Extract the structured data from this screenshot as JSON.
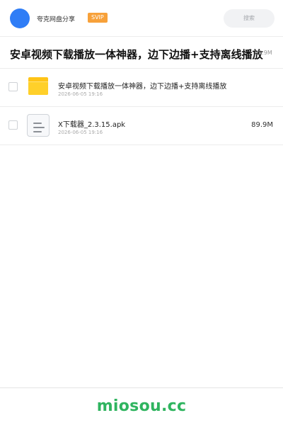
{
  "header": {
    "app_name": "夸克网盘分享",
    "badge": "SVIP",
    "search_placeholder": "搜索",
    "avatar_color": "#2f7df6",
    "badge_color": "#f7a13a"
  },
  "folder": {
    "title": "安卓视频下载播放一体神器，边下边播+支持离线播放",
    "total_size": "89.9M"
  },
  "files": [
    {
      "icon": "folder-icon",
      "name": "安卓视频下载播放一体神器，边下边播+支持离线播放",
      "date": "2026-06-05 19:16",
      "size": ""
    },
    {
      "icon": "apk-file-icon",
      "name": "X下载器_2.3.15.apk",
      "date": "2026-06-05 19:16",
      "size": "89.9M"
    }
  ],
  "footer": {
    "watermark": "miosou.cc",
    "watermark_color": "#2fb45f"
  }
}
